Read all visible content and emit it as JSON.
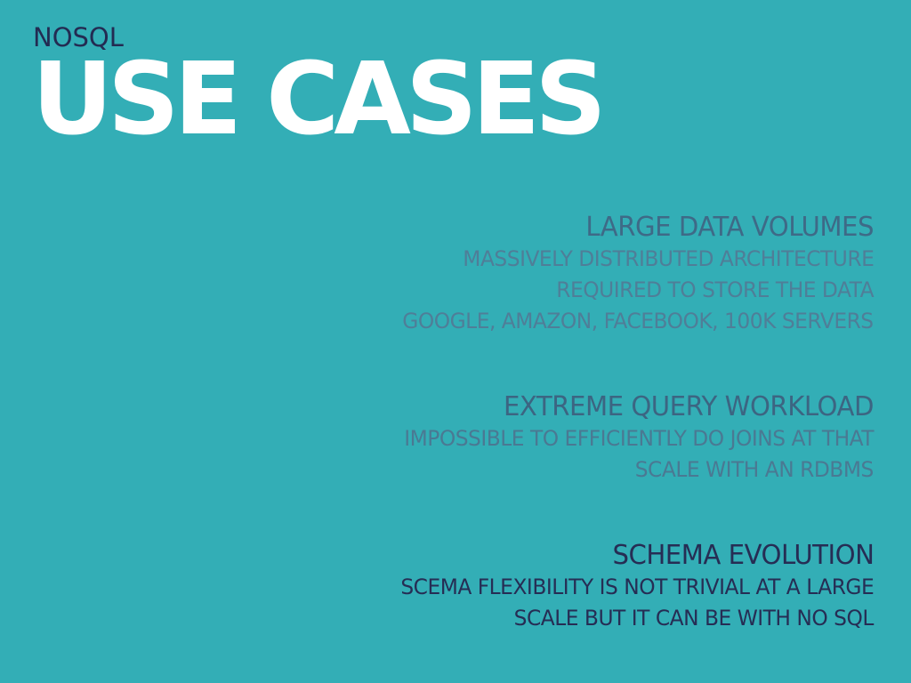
{
  "slide": {
    "kicker": "NOSQL",
    "title": "USE CASES",
    "sections": [
      {
        "heading": "LARGE DATA VOLUMES",
        "lines": [
          "MASSIVELY DISTRIBUTED ARCHITECTURE",
          "REQUIRED TO STORE THE DATA",
          "GOOGLE, AMAZON, FACEBOOK, 100K SERVERS"
        ]
      },
      {
        "heading": "EXTREME QUERY WORKLOAD",
        "lines": [
          "IMPOSSIBLE TO EFFICIENTLY DO JOINS AT THAT",
          "SCALE WITH AN RDBMS"
        ]
      },
      {
        "heading": "SCHEMA EVOLUTION",
        "lines": [
          "SCEMA FLEXIBILITY IS NOT TRIVIAL AT A LARGE",
          "SCALE BUT IT CAN BE WITH NO SQL"
        ]
      }
    ]
  },
  "colors": {
    "background": "#33aeb6",
    "title": "#ffffff",
    "dark_navy": "#232b52",
    "muted_blue": "#4f7e98"
  }
}
